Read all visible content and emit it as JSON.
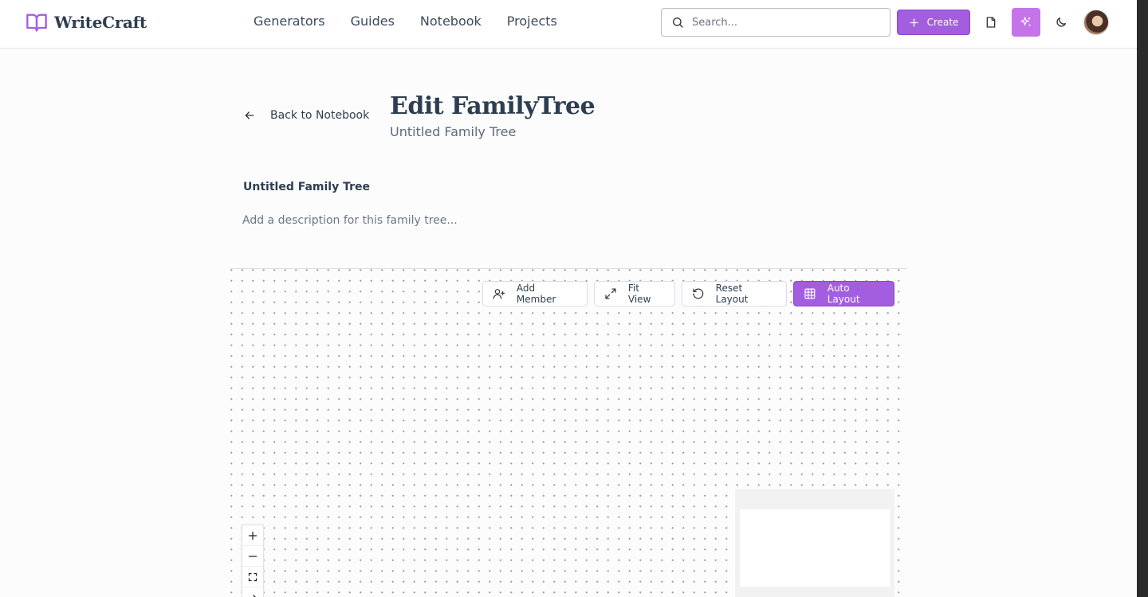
{
  "app": {
    "name": "WriteCraft"
  },
  "nav": {
    "items": [
      "Generators",
      "Guides",
      "Notebook",
      "Projects"
    ]
  },
  "search": {
    "placeholder": "Search..."
  },
  "header": {
    "create_label": "Create",
    "accent": "#a35ee0"
  },
  "page": {
    "back_label": "Back to Notebook",
    "title": "Edit FamilyTree",
    "subtitle": "Untitled Family Tree"
  },
  "tree": {
    "name": "Untitled Family Tree",
    "description_placeholder": "Add a description for this family tree..."
  },
  "toolbar": {
    "add_member": "Add Member",
    "fit_view": "Fit View",
    "reset_layout": "Reset Layout",
    "auto_layout": "Auto Layout"
  }
}
